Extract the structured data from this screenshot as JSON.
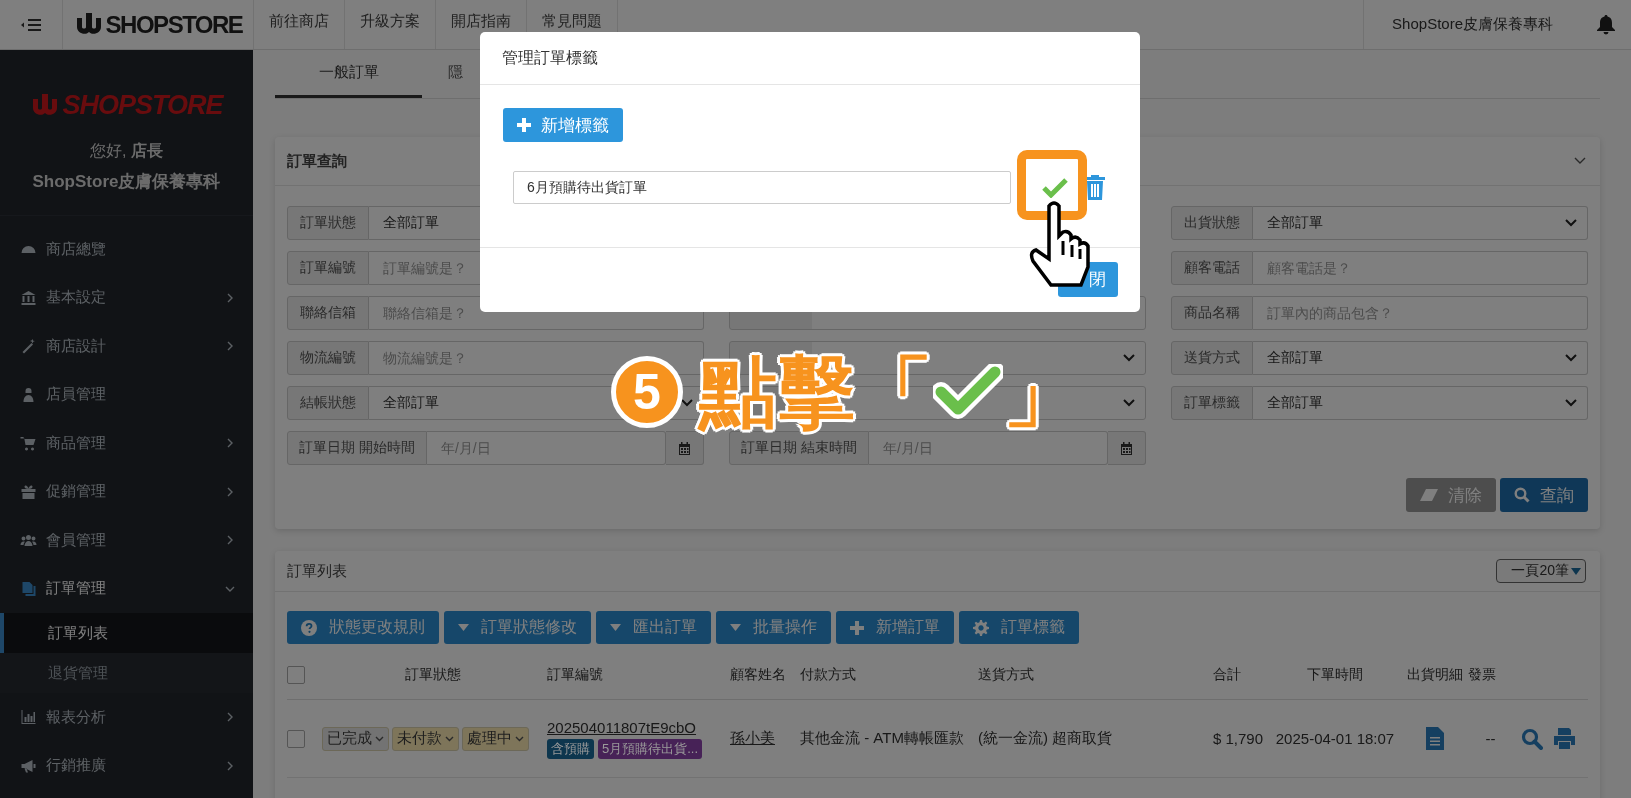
{
  "top_bar": {
    "logo": "SHOPSTORE",
    "nav": [
      "前往商店",
      "升級方案",
      "開店指南",
      "常見問題"
    ],
    "store_name": "ShopStore皮膚保養專科"
  },
  "sidebar": {
    "logo": "SHOPSTORE",
    "greeting": "您好, **店長**",
    "store_name": "ShopStore皮膚保養專科",
    "items": [
      {
        "label": "商店總覽",
        "expandable": false,
        "selected": false
      },
      {
        "label": "基本設定",
        "expandable": true,
        "expanded": false,
        "selected": false
      },
      {
        "label": "商店設計",
        "expandable": true,
        "expanded": false,
        "selected": false
      },
      {
        "label": "店員管理",
        "expandable": false,
        "selected": false
      },
      {
        "label": "商品管理",
        "expandable": true,
        "expanded": false,
        "selected": false
      },
      {
        "label": "促銷管理",
        "expandable": true,
        "expanded": false,
        "selected": false
      },
      {
        "label": "會員管理",
        "expandable": true,
        "expanded": false,
        "selected": false
      },
      {
        "label": "訂單管理",
        "expandable": true,
        "expanded": true,
        "selected": true,
        "children": [
          {
            "label": "訂單列表",
            "selected": true
          },
          {
            "label": "退貨管理",
            "selected": false
          }
        ]
      },
      {
        "label": "報表分析",
        "expandable": true,
        "expanded": false,
        "selected": false
      },
      {
        "label": "行銷推廣",
        "expandable": true,
        "expanded": false,
        "selected": false
      }
    ]
  },
  "tabs": [
    {
      "label": "一般訂單",
      "selected": true
    },
    {
      "label": "隱",
      "selected": false
    }
  ],
  "search": {
    "title": "訂單查詢",
    "columns": [
      {
        "fields": [
          {
            "label": "訂單狀態",
            "kind": "select",
            "value": "全部訂單"
          },
          {
            "label": "訂單編號",
            "kind": "input",
            "placeholder": "訂單編號是？"
          },
          {
            "label": "聯絡信箱",
            "kind": "input",
            "placeholder": "聯絡信箱是？"
          },
          {
            "label": "物流編號",
            "kind": "input",
            "placeholder": "物流編號是？"
          },
          {
            "label": "結帳狀態",
            "kind": "select",
            "value": "全部訂單"
          },
          {
            "label": "訂單日期 開始時間",
            "kind": "date",
            "placeholder": "年/月/日"
          }
        ]
      },
      {
        "fields": [
          {
            "kind": "covered"
          },
          {
            "kind": "covered"
          },
          {
            "kind": "input"
          },
          {
            "kind": "select"
          },
          {
            "kind": "select"
          },
          {
            "label": "訂單日期 結束時間",
            "kind": "date",
            "placeholder": "年/月/日"
          }
        ]
      },
      {
        "fields": [
          {
            "label": "出貨狀態",
            "kind": "select",
            "value": "全部訂單"
          },
          {
            "label": "顧客電話",
            "kind": "input",
            "placeholder": "顧客電話是？"
          },
          {
            "label": "商品名稱",
            "kind": "input",
            "placeholder": "訂單內的商品包含？"
          },
          {
            "label": "送貨方式",
            "kind": "select",
            "value": "全部訂單"
          },
          {
            "label": "訂單標籤",
            "kind": "select",
            "value": "全部訂單"
          }
        ]
      }
    ],
    "buttons": [
      {
        "label": "清除",
        "disabled": true
      },
      {
        "label": "查詢",
        "disabled": false
      }
    ]
  },
  "orders": {
    "title": "訂單列表",
    "page_size": "一頁20筆",
    "actions": [
      "狀態更改規則",
      "訂單狀態修改",
      "匯出訂單",
      "批量操作",
      "新增訂單",
      "訂單標籤"
    ],
    "all_checked": false,
    "columns": [
      "訂單狀態",
      "訂單編號",
      "顧客姓名",
      "付款方式",
      "送貨方式",
      "合計",
      "下單時間",
      "出貨明細",
      "發票"
    ],
    "rows": [
      {
        "checked": false,
        "statuses": [
          {
            "label": "已完成",
            "color": "#737373"
          },
          {
            "label": "未付款",
            "color": "#7e755a"
          },
          {
            "label": "處理中",
            "color": "#7e755a"
          }
        ],
        "order_no": "202504011807tE9cbO",
        "tags": [
          {
            "label": "含預購",
            "color": "#0d364e"
          },
          {
            "label": "5月預購待出貨...",
            "color": "#472257"
          }
        ],
        "customer": "孫小美",
        "payment": "其他金流 - ATM轉帳匯款",
        "shipping": "(統一金流) 超商取貨",
        "total": "$ 1,790",
        "time": "2025-04-01 18:07",
        "invoice": "--"
      }
    ]
  },
  "modal": {
    "title": "管理訂單標籤",
    "add_button": "新增標籤",
    "tags": [
      {
        "value": "6月預購待出貨訂單"
      }
    ],
    "close_button": "閉"
  },
  "annotation": {
    "step": "5",
    "text_before": "點擊「",
    "text_after": "」"
  }
}
